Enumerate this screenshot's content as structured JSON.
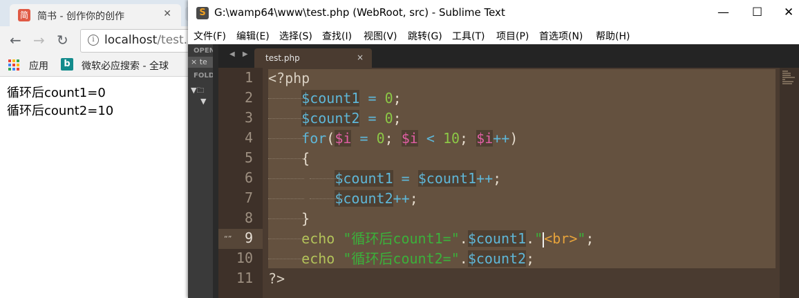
{
  "browser": {
    "tab_title": "简书 - 创作你的创作",
    "tab_close": "✕",
    "favicon_glyph": "简",
    "url_host": "localhost",
    "url_path": "/test.p",
    "bookmarks": [
      {
        "label": "应用"
      },
      {
        "label": "微软必应搜索 - 全球"
      }
    ],
    "content_lines": [
      "循环后count1=0",
      "循环后count2=10"
    ]
  },
  "sublime": {
    "title": "G:\\wamp64\\www\\test.php (WebRoot, src) - Sublime Text",
    "app_icon_glyph": "S",
    "window_buttons": {
      "minimize": "—",
      "maximize": "☐",
      "close": "✕"
    },
    "menu": [
      "文件(F)",
      "编辑(E)",
      "选择(S)",
      "查找(I)",
      "视图(V)",
      "跳转(G)",
      "工具(T)",
      "项目(P)",
      "首选项(N)",
      "帮助(H)"
    ],
    "sidebar": {
      "open_files_header": "OPEN",
      "open_file_item": "te",
      "folders_header": "FOLD",
      "folder_glyph": "🗀"
    },
    "tab": {
      "label": "test.php",
      "close": "×"
    },
    "tab_arrows": "◀ ▶",
    "line_numbers": [
      "1",
      "2",
      "3",
      "4",
      "5",
      "6",
      "7",
      "8",
      "9",
      "10",
      "11"
    ],
    "current_line": "9",
    "fold_marker": "“”",
    "code": {
      "open_tag": "<?php",
      "count1": "$count1",
      "count2": "$count2",
      "assign": "=",
      "zero": "0",
      "ten": "10",
      "semi": ";",
      "for_kw": "for",
      "paren_open": "(",
      "paren_close": ")",
      "i_dollar": "$",
      "i_name": "i",
      "lt": "<",
      "inc": "++",
      "brace_open": "{",
      "brace_close": "}",
      "echo_kw": "echo",
      "str1": "\"循环后count1=\"",
      "str2": "\"循环后count2=\"",
      "dot": ".",
      "quote": "\"",
      "br_tag": "<br>",
      "close_tag": "?>"
    },
    "colors": {
      "editor_bg": "#4a3b30",
      "variable": "#5fb7d8",
      "number": "#8cc846",
      "string": "#3bb13b",
      "keyword_echo": "#b3c35a"
    }
  }
}
